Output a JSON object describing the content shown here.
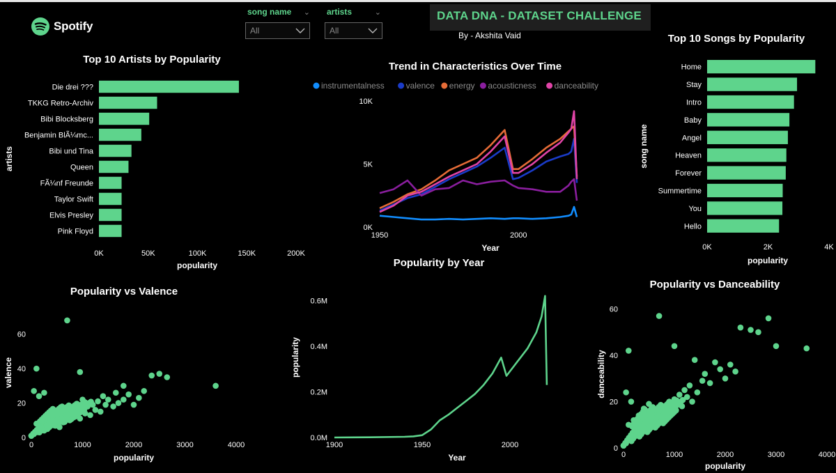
{
  "header": {
    "logo_text": "Spotify",
    "banner_title": "DATA DNA - DATASET CHALLENGE",
    "byline": "By - Akshita Vaid"
  },
  "slicers": [
    {
      "title": "song name",
      "value": "All"
    },
    {
      "title": "artists",
      "value": "All"
    }
  ],
  "colors": {
    "accent": "#5ed48c",
    "background": "#000000",
    "text": "#ffffff"
  },
  "chart_data": [
    {
      "id": "top_artists",
      "type": "bar",
      "orientation": "horizontal",
      "title": "Top 10 Artists by Popularity",
      "xlabel": "popularity",
      "ylabel": "artists",
      "categories": [
        "Die drei ???",
        "TKKG Retro-Archiv",
        "Bibi Blocksberg",
        "Benjamin BlÃ¼mc...",
        "Bibi und Tina",
        "Queen",
        "FÃ¼nf Freunde",
        "Taylor Swift",
        "Elvis Presley",
        "Pink Floyd"
      ],
      "values": [
        142000,
        59000,
        51000,
        43000,
        33000,
        30000,
        23000,
        23000,
        23000,
        23000
      ],
      "xlim": [
        0,
        200000
      ],
      "xticks": [
        "0K",
        "50K",
        "100K",
        "150K",
        "200K"
      ],
      "color": "#5ed48c"
    },
    {
      "id": "trend",
      "type": "line",
      "title": "Trend in Characteristics Over Time",
      "xlabel": "Year",
      "ylabel": "",
      "xlim": [
        1950,
        2021
      ],
      "ylim": [
        0,
        10000
      ],
      "xticks": [
        "1950",
        "2000"
      ],
      "yticks": [
        "0K",
        "5K",
        "10K"
      ],
      "x": [
        1950,
        1955,
        1960,
        1965,
        1970,
        1975,
        1980,
        1985,
        1990,
        1995,
        1998,
        2000,
        2005,
        2010,
        2015,
        2018,
        2019,
        2020,
        2021
      ],
      "series": [
        {
          "name": "instrumentalness",
          "color": "#118dff",
          "values": [
            900,
            800,
            700,
            600,
            600,
            650,
            600,
            650,
            700,
            650,
            700,
            700,
            650,
            700,
            800,
            900,
            1000,
            1600,
            800
          ]
        },
        {
          "name": "valence",
          "color": "#1a3bc8",
          "values": [
            1300,
            1800,
            2300,
            2600,
            3200,
            3800,
            4300,
            4800,
            5500,
            6300,
            3800,
            3900,
            4500,
            5200,
            5600,
            5800,
            6000,
            7000,
            3500
          ]
        },
        {
          "name": "energy",
          "color": "#e66c37",
          "values": [
            1500,
            2000,
            2600,
            3000,
            3700,
            4500,
            5000,
            5500,
            6500,
            7700,
            4600,
            4600,
            5400,
            6300,
            7000,
            7600,
            7800,
            8000,
            4000
          ]
        },
        {
          "name": "acousticness",
          "color": "#8a1e9e",
          "values": [
            2700,
            3000,
            3700,
            2500,
            3000,
            3100,
            3700,
            3400,
            3600,
            3700,
            3300,
            3100,
            3000,
            2800,
            2800,
            3300,
            3600,
            3800,
            2100
          ]
        },
        {
          "name": "danceability",
          "color": "#e044a7",
          "values": [
            1200,
            1700,
            2500,
            2800,
            3400,
            4000,
            4500,
            5000,
            6000,
            7200,
            4300,
            4300,
            5000,
            5900,
            6700,
            7500,
            7800,
            9200,
            3800
          ]
        }
      ]
    },
    {
      "id": "top_songs",
      "type": "bar",
      "orientation": "horizontal",
      "title": "Top 10 Songs by Popularity",
      "xlabel": "popularity",
      "ylabel": "song name",
      "categories": [
        "Home",
        "Stay",
        "Intro",
        "Baby",
        "Angel",
        "Heaven",
        "Forever",
        "Summertime",
        "You",
        "Hello"
      ],
      "values": [
        3550,
        2950,
        2850,
        2700,
        2650,
        2600,
        2580,
        2480,
        2470,
        2360
      ],
      "xlim": [
        0,
        4000
      ],
      "xticks": [
        "0K",
        "2K",
        "4K"
      ],
      "color": "#5ed48c"
    },
    {
      "id": "pop_valence",
      "type": "scatter",
      "title": "Popularity vs Valence",
      "xlabel": "popularity",
      "ylabel": "valence",
      "xlim": [
        0,
        4000
      ],
      "ylim": [
        0,
        70
      ],
      "xticks": [
        "0",
        "1000",
        "2000",
        "3000",
        "4000"
      ],
      "yticks": [
        "0",
        "20",
        "40",
        "60"
      ],
      "points": [
        [
          700,
          68
        ],
        [
          100,
          40
        ],
        [
          950,
          38
        ],
        [
          2500,
          37
        ],
        [
          2650,
          35
        ],
        [
          2350,
          36
        ],
        [
          3600,
          30
        ],
        [
          1800,
          30
        ],
        [
          2200,
          27
        ],
        [
          1650,
          26
        ],
        [
          1900,
          25
        ],
        [
          1500,
          22
        ],
        [
          1300,
          21
        ],
        [
          1200,
          19
        ],
        [
          1100,
          18
        ],
        [
          1000,
          17
        ],
        [
          900,
          15
        ],
        [
          800,
          14
        ],
        [
          700,
          13
        ],
        [
          600,
          11
        ],
        [
          500,
          10
        ],
        [
          400,
          9
        ],
        [
          300,
          7
        ],
        [
          200,
          5
        ],
        [
          100,
          3
        ],
        [
          50,
          2
        ],
        [
          1700,
          20
        ],
        [
          1400,
          24
        ],
        [
          1600,
          18
        ],
        [
          1250,
          16
        ],
        [
          1050,
          14
        ],
        [
          850,
          12
        ],
        [
          650,
          9
        ],
        [
          450,
          7
        ],
        [
          250,
          4
        ],
        [
          150,
          6
        ],
        [
          350,
          8
        ],
        [
          550,
          6
        ],
        [
          750,
          10
        ],
        [
          950,
          11
        ],
        [
          1150,
          13
        ],
        [
          1350,
          15
        ],
        [
          2000,
          19
        ],
        [
          1800,
          22
        ],
        [
          2100,
          23
        ],
        [
          300,
          12
        ],
        [
          200,
          10
        ],
        [
          100,
          8
        ],
        [
          400,
          14
        ],
        [
          500,
          15
        ],
        [
          50,
          27
        ],
        [
          150,
          24
        ],
        [
          250,
          26
        ],
        [
          600,
          18
        ],
        [
          1000,
          22
        ],
        [
          1450,
          19
        ]
      ],
      "color": "#5ed48c"
    },
    {
      "id": "pop_year",
      "type": "line",
      "title": "Popularity by Year",
      "xlabel": "Year",
      "ylabel": "popularity",
      "xlim": [
        1900,
        2025
      ],
      "ylim": [
        0,
        650000
      ],
      "xticks": [
        "1900",
        "1950",
        "2000"
      ],
      "yticks": [
        "0.0M",
        "0.2M",
        "0.4M",
        "0.6M"
      ],
      "x": [
        1900,
        1920,
        1940,
        1945,
        1950,
        1955,
        1960,
        1965,
        1970,
        1975,
        1980,
        1985,
        1990,
        1995,
        1998,
        2000,
        2005,
        2010,
        2015,
        2018,
        2020,
        2021
      ],
      "values": [
        0,
        1000,
        3000,
        5000,
        10000,
        35000,
        75000,
        100000,
        130000,
        160000,
        190000,
        230000,
        280000,
        350000,
        270000,
        290000,
        340000,
        390000,
        460000,
        530000,
        620000,
        230000
      ],
      "color": "#5ed48c"
    },
    {
      "id": "pop_dance",
      "type": "scatter",
      "title": "Popularity vs Danceability",
      "xlabel": "popularity",
      "ylabel": "danceability",
      "xlim": [
        0,
        4000
      ],
      "ylim": [
        0,
        65
      ],
      "xticks": [
        "0",
        "1000",
        "2000",
        "3000",
        "4000"
      ],
      "yticks": [
        "0",
        "20",
        "40",
        "60"
      ],
      "points": [
        [
          700,
          57
        ],
        [
          2850,
          56
        ],
        [
          2300,
          52
        ],
        [
          2500,
          51
        ],
        [
          2650,
          50
        ],
        [
          3600,
          43
        ],
        [
          3000,
          44
        ],
        [
          1000,
          44
        ],
        [
          100,
          42
        ],
        [
          1400,
          38
        ],
        [
          1800,
          37
        ],
        [
          2100,
          36
        ],
        [
          1900,
          34
        ],
        [
          1600,
          32
        ],
        [
          1550,
          29
        ],
        [
          1300,
          27
        ],
        [
          1200,
          25
        ],
        [
          1100,
          23
        ],
        [
          1000,
          21
        ],
        [
          900,
          20
        ],
        [
          800,
          18
        ],
        [
          700,
          16
        ],
        [
          600,
          14
        ],
        [
          500,
          12
        ],
        [
          400,
          10
        ],
        [
          300,
          8
        ],
        [
          200,
          6
        ],
        [
          100,
          4
        ],
        [
          50,
          2
        ],
        [
          1700,
          28
        ],
        [
          1450,
          24
        ],
        [
          1250,
          22
        ],
        [
          1050,
          19
        ],
        [
          850,
          17
        ],
        [
          650,
          13
        ],
        [
          450,
          11
        ],
        [
          250,
          7
        ],
        [
          150,
          5
        ],
        [
          350,
          9
        ],
        [
          550,
          15
        ],
        [
          750,
          12
        ],
        [
          950,
          16
        ],
        [
          1150,
          18
        ],
        [
          1350,
          20
        ],
        [
          2000,
          30
        ],
        [
          2200,
          33
        ],
        [
          300,
          14
        ],
        [
          200,
          12
        ],
        [
          100,
          10
        ],
        [
          400,
          17
        ],
        [
          500,
          19
        ],
        [
          50,
          24
        ],
        [
          150,
          20
        ]
      ],
      "color": "#5ed48c"
    }
  ]
}
